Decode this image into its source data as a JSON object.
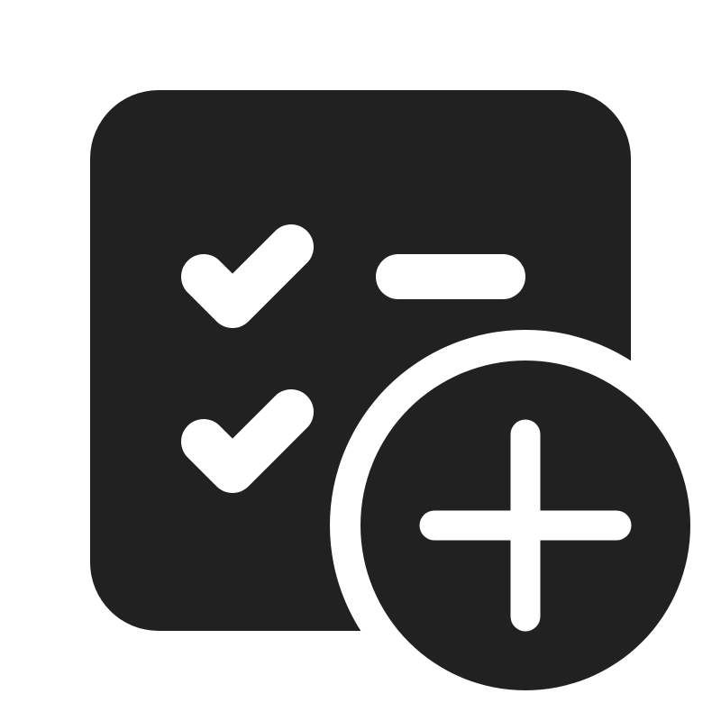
{
  "icon": {
    "name": "checklist-add-icon",
    "colors": {
      "background": "#ffffff",
      "fill": "#212121",
      "mark": "#ffffff"
    },
    "parts": [
      "checklist-board",
      "checkmark",
      "checkmark",
      "dash",
      "add-badge",
      "plus-sign"
    ]
  }
}
